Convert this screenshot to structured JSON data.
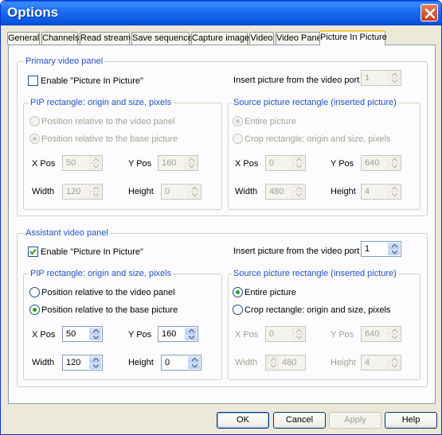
{
  "window": {
    "title": "Options"
  },
  "tabs": [
    "General",
    "Channels",
    "Read stream",
    "Save sequence",
    "Capture image",
    "Video",
    "Video Panel",
    "Picture In Picture"
  ],
  "primary": {
    "title": "Primary video panel",
    "enable_label": "Enable \"Picture In Picture\"",
    "enable_checked": false,
    "port_label": "Insert picture from the video port",
    "port_value": "1",
    "pip": {
      "title": "PIP rectangle: origin and size, pixels",
      "radio_video": "Position relative to the video panel",
      "radio_base": "Position relative to the base picture",
      "xpos_label": "X Pos",
      "xpos": "50",
      "ypos_label": "Y Pos",
      "ypos": "160",
      "width_label": "Width",
      "width": "120",
      "height_label": "Height",
      "height": "0"
    },
    "source": {
      "title": "Source picture rectangle (inserted picture)",
      "radio_entire": "Entire picture",
      "radio_crop": "Crop rectangle: origin and size, pixels",
      "xpos_label": "X Pos",
      "xpos": "0",
      "ypos_label": "Y Pos",
      "ypos": "640",
      "width_label": "Width",
      "width": "480",
      "height_label": "Height",
      "height": "4"
    }
  },
  "assistant": {
    "title": "Assistant video panel",
    "enable_label": "Enable \"Picture In Picture\"",
    "enable_checked": true,
    "port_label": "Insert picture from the video port",
    "port_value": "1",
    "pip": {
      "title": "PIP rectangle: origin and size, pixels",
      "radio_video": "Position relative to the video panel",
      "radio_base": "Position relative to the base picture",
      "xpos_label": "X Pos",
      "xpos": "50",
      "ypos_label": "Y Pos",
      "ypos": "160",
      "width_label": "Width",
      "width": "120",
      "height_label": "Height",
      "height": "0"
    },
    "source": {
      "title": "Source picture rectangle (inserted picture)",
      "radio_entire": "Entire picture",
      "radio_crop": "Crop rectangle: origin and size, pixels",
      "xpos_label": "X Pos",
      "xpos": "0",
      "ypos_label": "Y Pos",
      "ypos": "640",
      "width_label": "Width",
      "width": "480",
      "height_label": "Height",
      "height": "4"
    }
  },
  "buttons": {
    "ok": "OK",
    "cancel": "Cancel",
    "apply": "Apply",
    "help": "Help"
  },
  "colors": {
    "title_bar": "#0a5be6",
    "group_title": "#2151c5",
    "radio_selected": "#21a121",
    "close_button": "#c8381a"
  },
  "icons": {
    "close": "close-icon",
    "spin_up": "chevron-up-icon",
    "spin_down": "chevron-down-icon",
    "check": "checkmark-icon"
  }
}
